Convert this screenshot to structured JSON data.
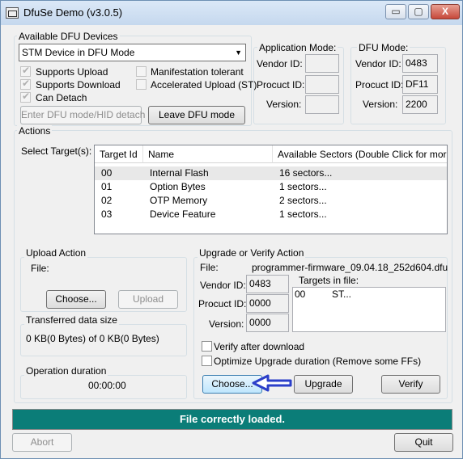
{
  "window": {
    "title": "DfuSe Demo (v3.0.5)",
    "minimize": "▭",
    "maximize": "▢",
    "close": "X"
  },
  "devices": {
    "group_label": "Available DFU Devices",
    "selected": "STM Device in DFU Mode",
    "supports_upload": "Supports Upload",
    "supports_download": "Supports Download",
    "can_detach": "Can Detach",
    "manifestation_tolerant": "Manifestation tolerant",
    "accelerated_upload": "Accelerated Upload (ST)",
    "enter_dfu_label": "Enter DFU mode/HID detach",
    "leave_dfu_label": "Leave DFU mode"
  },
  "app_mode": {
    "group_label": "Application Mode:",
    "vendor_id_label": "Vendor ID:",
    "procuct_id_label": "Procuct ID:",
    "version_label": "Version:",
    "vendor_id": "",
    "procuct_id": "",
    "version": ""
  },
  "dfu_mode": {
    "group_label": "DFU Mode:",
    "vendor_id_label": "Vendor ID:",
    "procuct_id_label": "Procuct ID:",
    "version_label": "Version:",
    "vendor_id": "0483",
    "procuct_id": "DF11",
    "version": "2200"
  },
  "actions": {
    "group_label": "Actions",
    "select_targets_label": "Select Target(s):",
    "columns": [
      "Target Id",
      "Name",
      "Available Sectors (Double Click for more)"
    ],
    "rows": [
      {
        "id": "00",
        "name": "Internal Flash",
        "sectors": "16 sectors..."
      },
      {
        "id": "01",
        "name": "Option Bytes",
        "sectors": "1 sectors..."
      },
      {
        "id": "02",
        "name": "OTP Memory",
        "sectors": "2 sectors..."
      },
      {
        "id": "03",
        "name": "Device Feature",
        "sectors": "1 sectors..."
      }
    ]
  },
  "upload": {
    "group_label": "Upload Action",
    "file_label": "File:",
    "choose_label": "Choose...",
    "upload_label": "Upload"
  },
  "transferred": {
    "group_label": "Transferred data size",
    "value": "0 KB(0 Bytes) of 0 KB(0 Bytes)"
  },
  "duration": {
    "group_label": "Operation duration",
    "value": "00:00:00"
  },
  "upgrade": {
    "group_label": "Upgrade or Verify Action",
    "file_label": "File:",
    "file_name": "programmer-firmware_09.04.18_252d604.dfu",
    "vendor_id_label": "Vendor ID:",
    "procuct_id_label": "Procuct ID:",
    "version_label": "Version:",
    "vendor_id": "0483",
    "procuct_id": "0000",
    "version": "0000",
    "targets_label": "Targets in file:",
    "target_id": "00",
    "target_name": "ST...",
    "verify_after_download": "Verify after download",
    "optimize": "Optimize Upgrade duration (Remove some FFs)",
    "choose_label": "Choose...",
    "upgrade_label": "Upgrade",
    "verify_label": "Verify"
  },
  "status_text": "File correctly loaded.",
  "footer": {
    "abort_label": "Abort",
    "quit_label": "Quit"
  },
  "colors": {
    "status_bg": "#0b7d78",
    "arrow": "#2b3fc9"
  }
}
